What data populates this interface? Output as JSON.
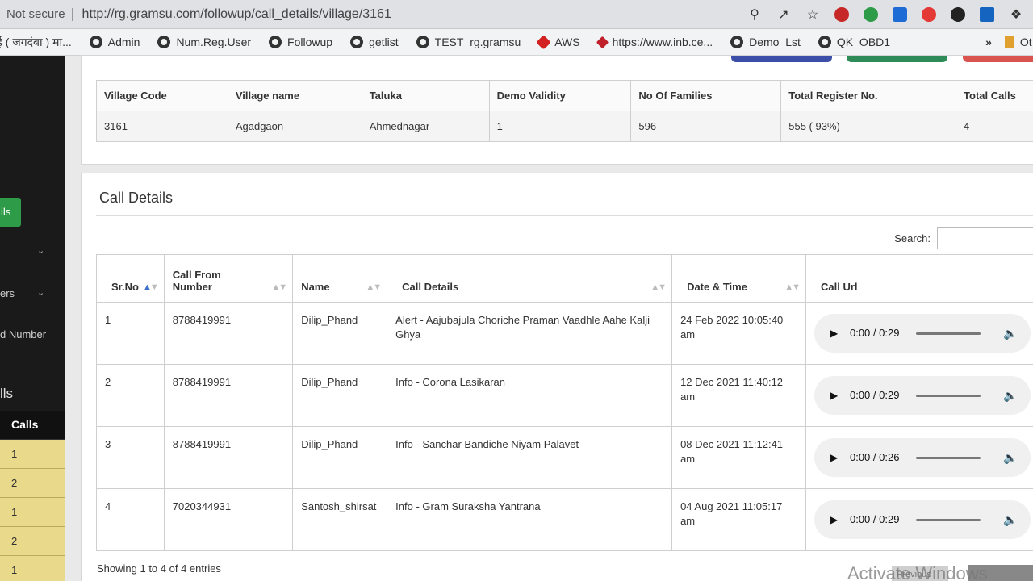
{
  "browser": {
    "security": "Not secure",
    "url": "http://rg.gramsu.com/followup/call_details/village/3161",
    "bookmarks": [
      "ई ( जगदंबा ) मा...",
      "Admin",
      "Num.Reg.User",
      "Followup",
      "getlist",
      "TEST_rg.gramsu",
      "AWS",
      "https://www.inb.ce...",
      "Demo_Lst",
      "QK_OBD1"
    ],
    "more": "»",
    "other_bookmarks": "Ot"
  },
  "sidebar": {
    "active_item": "ils",
    "items": [
      "ers",
      "d Number"
    ],
    "heading": "lls",
    "table_header": "Calls",
    "table_values": [
      "1",
      "2",
      "1",
      "2",
      "1"
    ]
  },
  "village": {
    "headers": [
      "Village Code",
      "Village name",
      "Taluka",
      "Demo Validity",
      "No Of Families",
      "Total Register No.",
      "Total Calls"
    ],
    "values": [
      "3161",
      "Agadgaon",
      "Ahmednagar",
      "1",
      "596",
      "555 ( 93%)",
      "4"
    ]
  },
  "call_details": {
    "title": "Call Details",
    "search_label": "Search:",
    "headers": [
      "Sr.No",
      "Call From Number",
      "Name",
      "Call Details",
      "Date & Time",
      "Call Url"
    ],
    "rows": [
      {
        "sr": "1",
        "number": "8788419991",
        "name": "Dilip_Phand",
        "details": "Alert - Aajubajula Choriche Praman Vaadhle Aahe Kalji Ghya",
        "datetime": "24 Feb 2022 10:05:40 am",
        "time": "0:00 / 0:29"
      },
      {
        "sr": "2",
        "number": "8788419991",
        "name": "Dilip_Phand",
        "details": "Info - Corona Lasikaran",
        "datetime": "12 Dec 2021 11:40:12 am",
        "time": "0:00 / 0:29"
      },
      {
        "sr": "3",
        "number": "8788419991",
        "name": "Dilip_Phand",
        "details": "Info - Sanchar Bandiche Niyam Palavet",
        "datetime": "08 Dec 2021 11:12:41 am",
        "time": "0:00 / 0:26"
      },
      {
        "sr": "4",
        "number": "7020344931",
        "name": "Santosh_shirsat",
        "details": "Info - Gram Suraksha Yantrana",
        "datetime": "04 Aug 2021 11:05:17 am",
        "time": "0:00 / 0:29"
      }
    ],
    "footer": "Showing 1 to 4 of 4 entries",
    "pager_prev": "Previous"
  },
  "watermark": "Activate Windows",
  "colors": {
    "sidebar_bg": "#1a1a1a",
    "active_green": "#2e9b48",
    "sidebar_table_bg": "#e8d98b"
  },
  "icons": [
    "play-icon",
    "volume-icon",
    "sort-icon",
    "zoom-icon",
    "share-icon",
    "star-icon",
    "globe-icon"
  ]
}
